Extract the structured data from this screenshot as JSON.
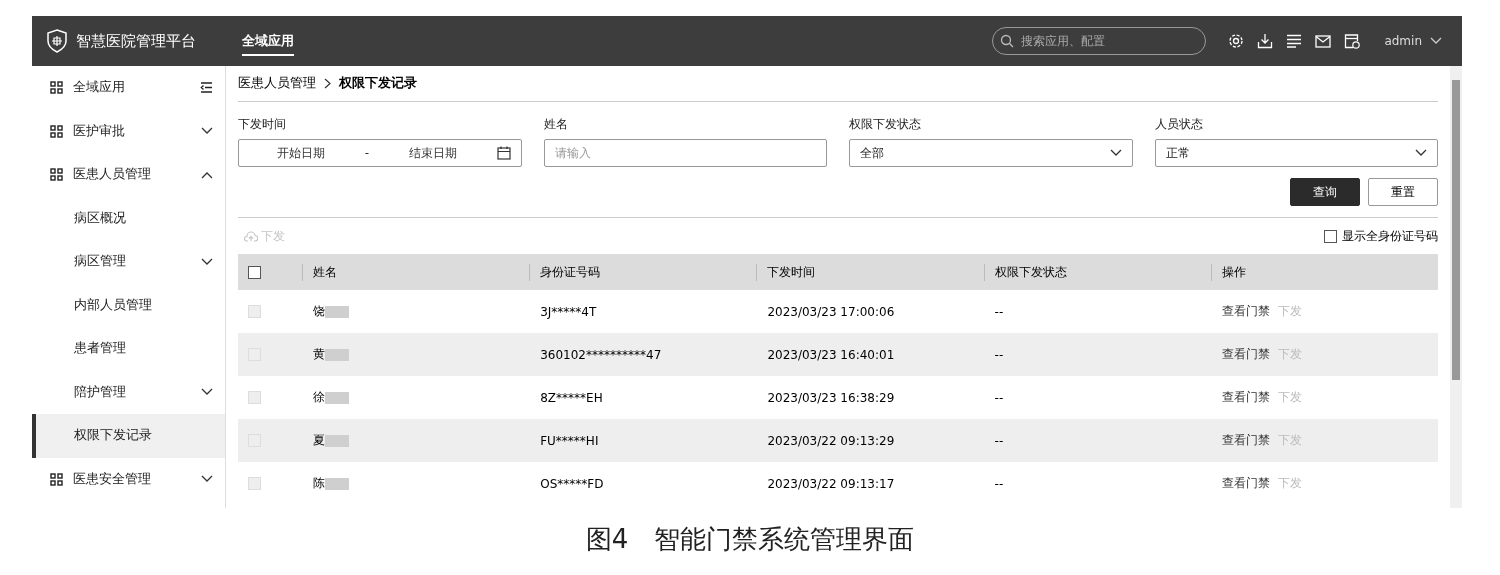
{
  "header": {
    "title": "智慧医院管理平台",
    "nav": [
      {
        "label": "全域应用",
        "selected": true
      }
    ],
    "search": {
      "placeholder": "搜索应用、配置"
    },
    "user": "admin"
  },
  "sidebar": {
    "items": [
      {
        "label": "全域应用",
        "kind": "collapse",
        "selected": false
      },
      {
        "label": "医护审批",
        "expanded": false,
        "selected": false
      },
      {
        "label": "医患人员管理",
        "expanded": true,
        "selected": false,
        "children": [
          {
            "label": "病区概况",
            "selected": false
          },
          {
            "label": "病区管理",
            "expanded": false,
            "selected": false
          },
          {
            "label": "内部人员管理",
            "selected": false
          },
          {
            "label": "患者管理",
            "selected": false
          },
          {
            "label": "陪护管理",
            "expanded": false,
            "selected": false
          },
          {
            "label": "权限下发记录",
            "selected": true
          }
        ]
      },
      {
        "label": "医患安全管理",
        "expanded": false,
        "selected": false
      }
    ]
  },
  "breadcrumb": [
    "医患人员管理",
    "权限下发记录"
  ],
  "filters": {
    "date": {
      "label": "下发时间",
      "start_placeholder": "开始日期",
      "separator": "-",
      "end_placeholder": "结束日期"
    },
    "name": {
      "label": "姓名",
      "placeholder": "请输入"
    },
    "status": {
      "label": "权限下发状态",
      "value": "全部"
    },
    "person_status": {
      "label": "人员状态",
      "value": "正常"
    },
    "buttons": [
      {
        "label": "查询",
        "kind": "primary"
      },
      {
        "label": "重置",
        "kind": "secondary"
      }
    ]
  },
  "toolbar": {
    "issue_button": {
      "label": "下发",
      "disabled": true
    },
    "show_full_id": {
      "label": "显示全身份证号码",
      "checked": false
    }
  },
  "table": {
    "select_all": {
      "checked": false
    },
    "columns": [
      "姓名",
      "身份证号码",
      "下发时间",
      "权限下发状态",
      "操作"
    ],
    "rows": [
      {
        "name": "饶",
        "id": "3J*****4T",
        "time": "2023/03/23 17:00:06",
        "status": "--",
        "actions": [
          {
            "label": "查看门禁",
            "disabled": false
          },
          {
            "label": "下发",
            "disabled": true
          }
        ],
        "disabled": true
      },
      {
        "name": "黄",
        "id": "360102**********47",
        "time": "2023/03/23 16:40:01",
        "status": "--",
        "actions": [
          {
            "label": "查看门禁",
            "disabled": false
          },
          {
            "label": "下发",
            "disabled": true
          }
        ],
        "disabled": true
      },
      {
        "name": "徐",
        "id": "8Z*****EH",
        "time": "2023/03/23 16:38:29",
        "status": "--",
        "actions": [
          {
            "label": "查看门禁",
            "disabled": false
          },
          {
            "label": "下发",
            "disabled": true
          }
        ],
        "disabled": true
      },
      {
        "name": "夏",
        "id": "FU*****HI",
        "time": "2023/03/22 09:13:29",
        "status": "--",
        "actions": [
          {
            "label": "查看门禁",
            "disabled": false
          },
          {
            "label": "下发",
            "disabled": true
          }
        ],
        "disabled": true
      },
      {
        "name": "陈",
        "id": "OS*****FD",
        "time": "2023/03/22 09:13:17",
        "status": "--",
        "actions": [
          {
            "label": "查看门禁",
            "disabled": false
          },
          {
            "label": "下发",
            "disabled": true
          }
        ],
        "disabled": true
      }
    ]
  },
  "caption": "图4　智能门禁系统管理界面"
}
